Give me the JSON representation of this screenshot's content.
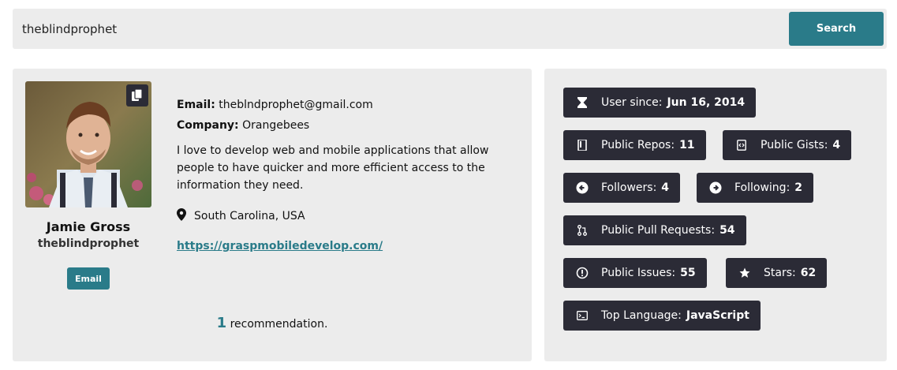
{
  "search": {
    "value": "theblindprophet",
    "button_label": "Search"
  },
  "profile": {
    "name": "Jamie Gross",
    "login": "theblindprophet",
    "email_button_label": "Email",
    "email_label": "Email:",
    "email_value": "theblndprophet@gmail.com",
    "company_label": "Company:",
    "company_value": "Orangebees",
    "bio": "I love to develop web and mobile applications that allow people to have quicker and more efficient access to the information they need.",
    "location": "South Carolina, USA",
    "blog": "https://graspmobiledevelop.com/",
    "recommendation_count": "1",
    "recommendation_text": "recommendation."
  },
  "stats": {
    "user_since_label": "User since:",
    "user_since_value": "Jun 16, 2014",
    "public_repos_label": "Public Repos:",
    "public_repos_value": "11",
    "public_gists_label": "Public Gists:",
    "public_gists_value": "4",
    "followers_label": "Followers:",
    "followers_value": "4",
    "following_label": "Following:",
    "following_value": "2",
    "pull_requests_label": "Public Pull Requests:",
    "pull_requests_value": "54",
    "issues_label": "Public Issues:",
    "issues_value": "55",
    "stars_label": "Stars:",
    "stars_value": "62",
    "top_language_label": "Top Language:",
    "top_language_value": "JavaScript"
  },
  "colors": {
    "accent": "#2a7b89",
    "badge": "#2b2b36",
    "panel": "#ececec"
  },
  "icons": [
    "copy-icon",
    "map-marker-icon",
    "hourglass-icon",
    "book-icon",
    "code-icon",
    "arrow-left-circle-icon",
    "arrow-right-circle-icon",
    "pull-request-icon",
    "issue-icon",
    "star-icon",
    "terminal-icon"
  ]
}
